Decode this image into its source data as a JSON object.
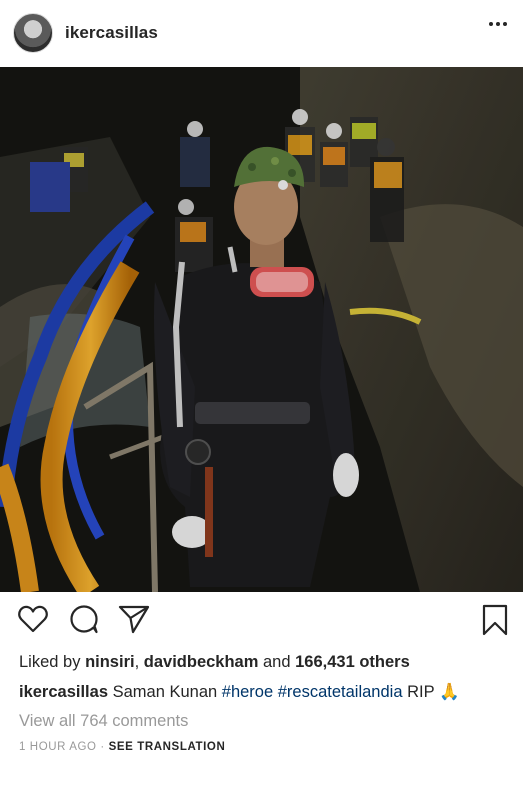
{
  "post": {
    "username": "ikercasillas",
    "more_icon": "ellipsis-icon"
  },
  "photo": {
    "alt": "Diver in wetsuit with mask and headlamp in a dark cave with rescue workers in helmets and vests behind him"
  },
  "actions": {
    "like_icon": "heart-icon",
    "comment_icon": "comment-icon",
    "share_icon": "paper-plane-icon",
    "save_icon": "bookmark-icon"
  },
  "likes": {
    "prefix": "Liked by",
    "user1": "ninsiri",
    "sep": ",",
    "user2": "davidbeckham",
    "and": "and",
    "count": "166,431 others"
  },
  "caption": {
    "username": "ikercasillas",
    "text": "Saman Kunan",
    "tag1": "#heroe",
    "tag2": "#rescatetailandia",
    "tail": "RIP",
    "emoji": "🙏"
  },
  "comments": {
    "view_all": "View all 764 comments"
  },
  "meta": {
    "time": "1 HOUR AGO",
    "dot": "·",
    "see_translation": "SEE TRANSLATION"
  },
  "colors": {
    "text": "#262626",
    "muted": "#999999",
    "hashtag": "#003569"
  }
}
